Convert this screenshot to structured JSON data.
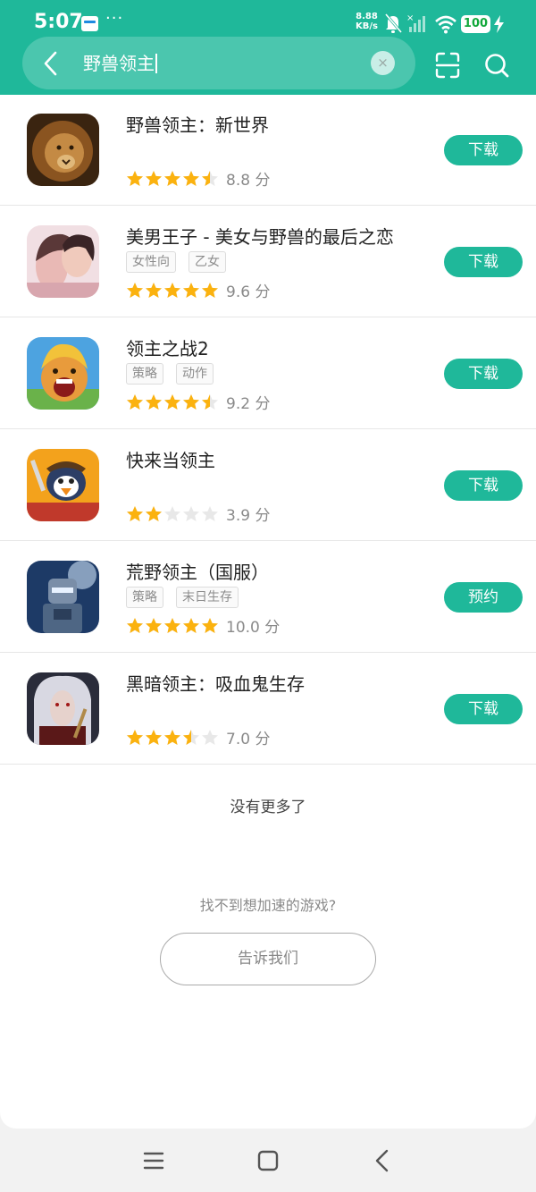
{
  "status_bar": {
    "time": "5:07",
    "speed_value": "8.88",
    "speed_unit": "KB/s",
    "battery": "100",
    "dots": "···"
  },
  "search": {
    "query": "野兽领主",
    "clear_symbol": "×"
  },
  "colors": {
    "accent": "#1fb89a",
    "star_filled": "#fbb20f",
    "star_empty": "#e8e8e8"
  },
  "games": [
    {
      "title": "野兽领主：新世界",
      "tags": [],
      "stars": 4.5,
      "score": "8.8 分",
      "button": "下载"
    },
    {
      "title": "美男王子 - 美女与野兽的最后之恋",
      "tags": [
        "女性向",
        "乙女"
      ],
      "stars": 5,
      "score": "9.6 分",
      "button": "下载"
    },
    {
      "title": "领主之战2",
      "tags": [
        "策略",
        "动作"
      ],
      "stars": 4.5,
      "score": "9.2 分",
      "button": "下载"
    },
    {
      "title": "快来当领主",
      "tags": [],
      "stars": 2,
      "score": "3.9 分",
      "button": "下载"
    },
    {
      "title": "荒野领主（国服）",
      "tags": [
        "策略",
        "末日生存"
      ],
      "stars": 5,
      "score": "10.0 分",
      "button": "预约"
    },
    {
      "title": "黑暗领主：吸血鬼生存",
      "tags": [],
      "stars": 3.5,
      "score": "7.0 分",
      "button": "下载"
    }
  ],
  "footer": {
    "no_more": "没有更多了",
    "not_found": "找不到想加速的游戏?",
    "tell_us": "告诉我们"
  },
  "icons": {
    "back": "chevron-left-icon",
    "scan": "scan-icon",
    "search": "search-icon",
    "nav_menu": "menu-icon",
    "nav_home": "home-square-icon",
    "nav_back": "back-triangle-icon"
  }
}
